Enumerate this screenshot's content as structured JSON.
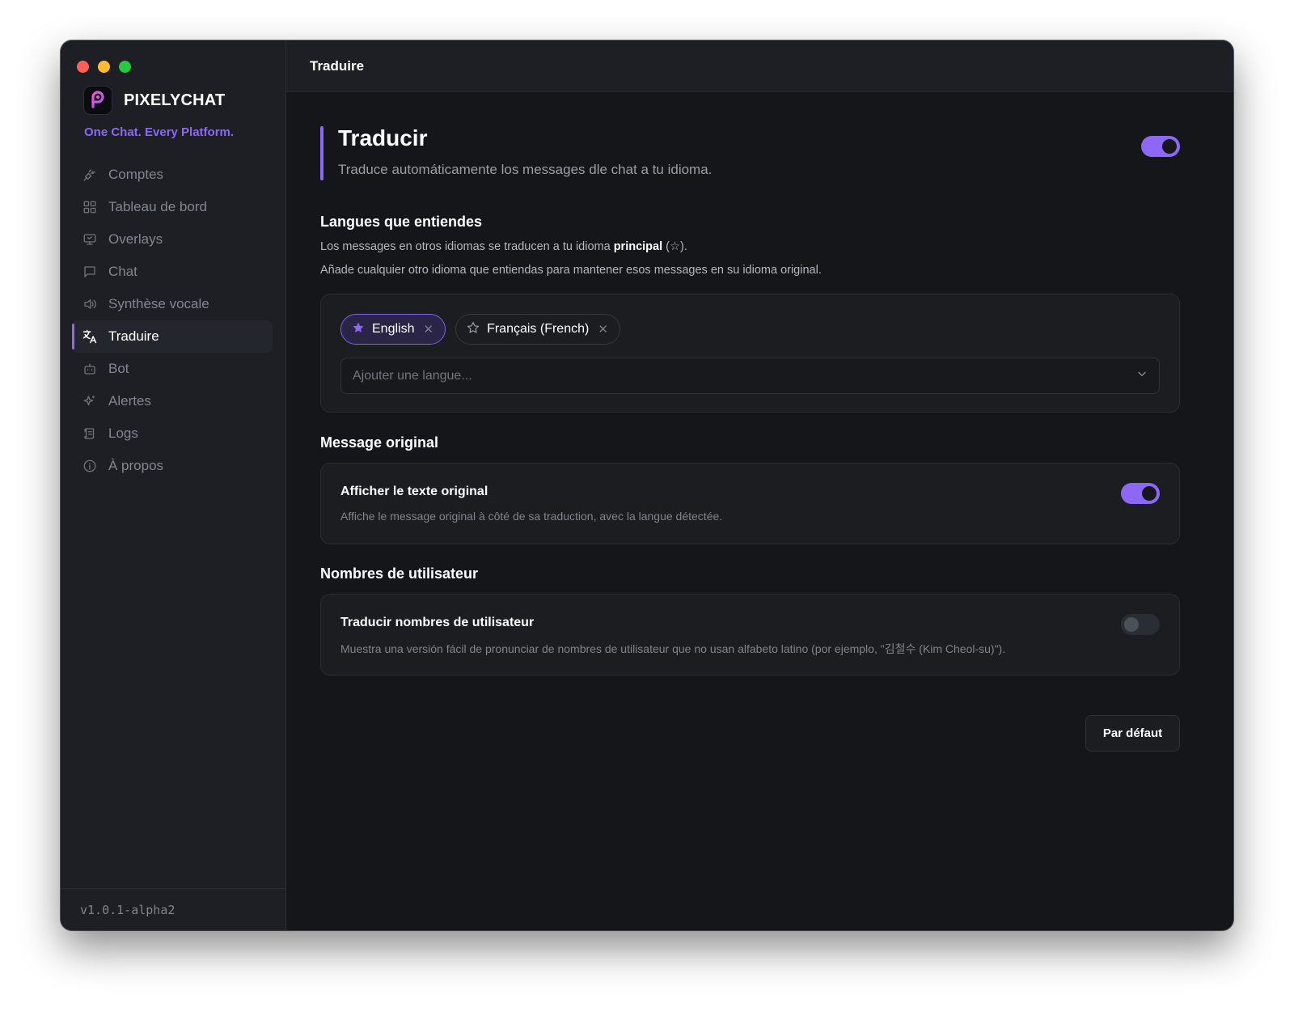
{
  "window": {
    "traffic_lights": [
      "close",
      "minimize",
      "zoom"
    ]
  },
  "sidebar": {
    "brand": "PIXELYCHAT",
    "tagline": "One Chat. Every Platform.",
    "items": [
      {
        "label": "Comptes",
        "icon": "plug-icon"
      },
      {
        "label": "Tableau de bord",
        "icon": "grid-icon"
      },
      {
        "label": "Overlays",
        "icon": "monitor-icon"
      },
      {
        "label": "Chat",
        "icon": "chat-bubble-icon"
      },
      {
        "label": "Synthèse vocale",
        "icon": "speaker-icon"
      },
      {
        "label": "Traduire",
        "icon": "translate-icon",
        "active": true
      },
      {
        "label": "Bot",
        "icon": "robot-icon"
      },
      {
        "label": "Alertes",
        "icon": "sparkle-icon"
      },
      {
        "label": "Logs",
        "icon": "scroll-icon"
      },
      {
        "label": "À propos",
        "icon": "info-icon"
      }
    ],
    "version": "v1.0.1-alpha2"
  },
  "topbar": {
    "title": "Traduire"
  },
  "hero": {
    "title": "Traducir",
    "subtitle": "Traduce automáticamente los messages dle chat a tu idioma.",
    "enabled": true
  },
  "languages": {
    "title": "Langues que entiendes",
    "desc1_pre": "Los messages en otros idiomas se traducen a tu idioma ",
    "desc1_bold": "principal",
    "desc1_post": " (☆).",
    "desc2": "Añade cualquier otro idioma que entiendas para mantener esos messages en su idioma original.",
    "chips": [
      {
        "label": "English",
        "primary": true
      },
      {
        "label": "Français (French)",
        "primary": false
      }
    ],
    "add_placeholder": "Ajouter une langue..."
  },
  "original": {
    "section_title": "Message original",
    "setting_title": "Afficher le texte original",
    "setting_desc": "Affiche le message original à côté de sa traduction, avec la langue détectée.",
    "enabled": true
  },
  "usernames": {
    "section_title": "Nombres de utilisateur",
    "setting_title": "Traducir nombres de utilisateur",
    "setting_desc": "Muestra una versión fácil de pronunciar de nombres de utilisateur que no usan alfabeto latino (por ejemplo, \"김철수 (Kim Cheol-su)\").",
    "enabled": false
  },
  "footer": {
    "reset_label": "Par défaut"
  },
  "colors": {
    "accent": "#8d68f5",
    "background": "#141619",
    "sidebar": "#1d1f24",
    "card": "#1b1d21"
  }
}
